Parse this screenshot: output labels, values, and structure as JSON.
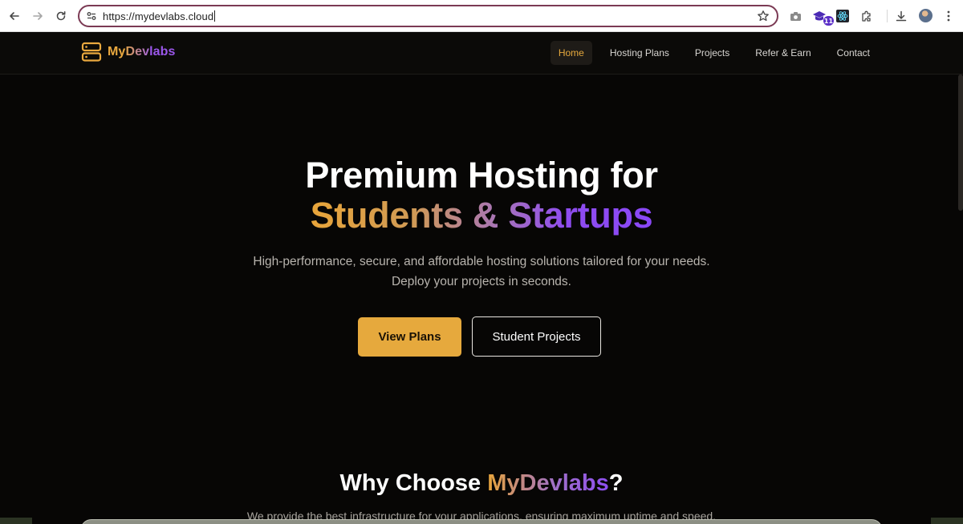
{
  "browser": {
    "url": "https://mydevlabs.cloud",
    "extension_badge": "11"
  },
  "site": {
    "logo": {
      "part1": "My",
      "part2": "Dev",
      "part3": "labs"
    },
    "nav": [
      {
        "label": "Home",
        "active": true
      },
      {
        "label": "Hosting Plans",
        "active": false
      },
      {
        "label": "Projects",
        "active": false
      },
      {
        "label": "Refer & Earn",
        "active": false
      },
      {
        "label": "Contact",
        "active": false
      }
    ]
  },
  "hero": {
    "title_line1": "Premium Hosting for",
    "title_line2": "Students & Startups",
    "subtitle": "High-performance, secure, and affordable hosting solutions tailored for your needs. Deploy your projects in seconds.",
    "primary_button": "View Plans",
    "secondary_button": "Student Projects"
  },
  "why": {
    "title_prefix": "Why Choose ",
    "title_brand": "MyDevlabs",
    "title_suffix": "?",
    "subtitle": "We provide the best infrastructure for your applications, ensuring maximum uptime and speed."
  },
  "colors": {
    "accent": "#e6a93d",
    "purple": "#8b48f5",
    "background": "#070605"
  }
}
